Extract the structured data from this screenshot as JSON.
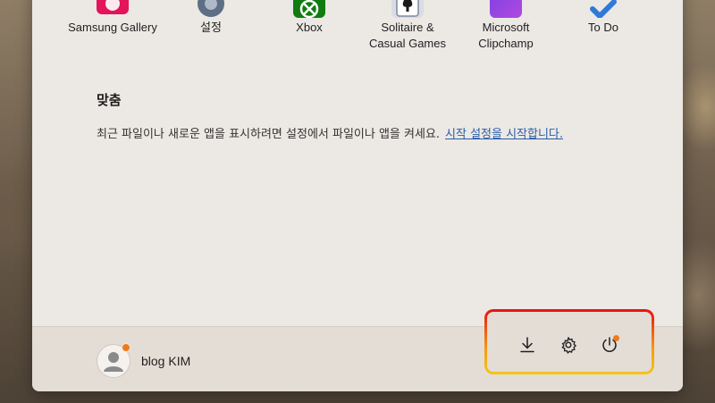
{
  "pinned_apps": [
    {
      "label": "Samsung Gallery",
      "icon": "samsung-gallery-icon"
    },
    {
      "label": "설정",
      "icon": "settings-gear-icon"
    },
    {
      "label": "Xbox",
      "icon": "xbox-icon"
    },
    {
      "label": "Solitaire &\nCasual Games",
      "icon": "solitaire-icon"
    },
    {
      "label": "Microsoft\nClipchamp",
      "icon": "clipchamp-icon"
    },
    {
      "label": "To Do",
      "icon": "todo-icon"
    }
  ],
  "recommended": {
    "title": "맞춤",
    "text": "최근 파일이나 새로운 앱을 표시하려면 설정에서 파일이나 앱을 켜세요.",
    "link": "시작 설정을 시작합니다."
  },
  "footer": {
    "user_name": "blog KIM",
    "buttons": [
      {
        "icon": "download-icon"
      },
      {
        "icon": "settings-gear-icon"
      },
      {
        "icon": "power-icon"
      }
    ]
  },
  "colors": {
    "accent_link": "#2a5ea8",
    "notification_dot": "#f07a1c",
    "highlight_top": "#e81010",
    "highlight_bottom": "#f5c518"
  }
}
